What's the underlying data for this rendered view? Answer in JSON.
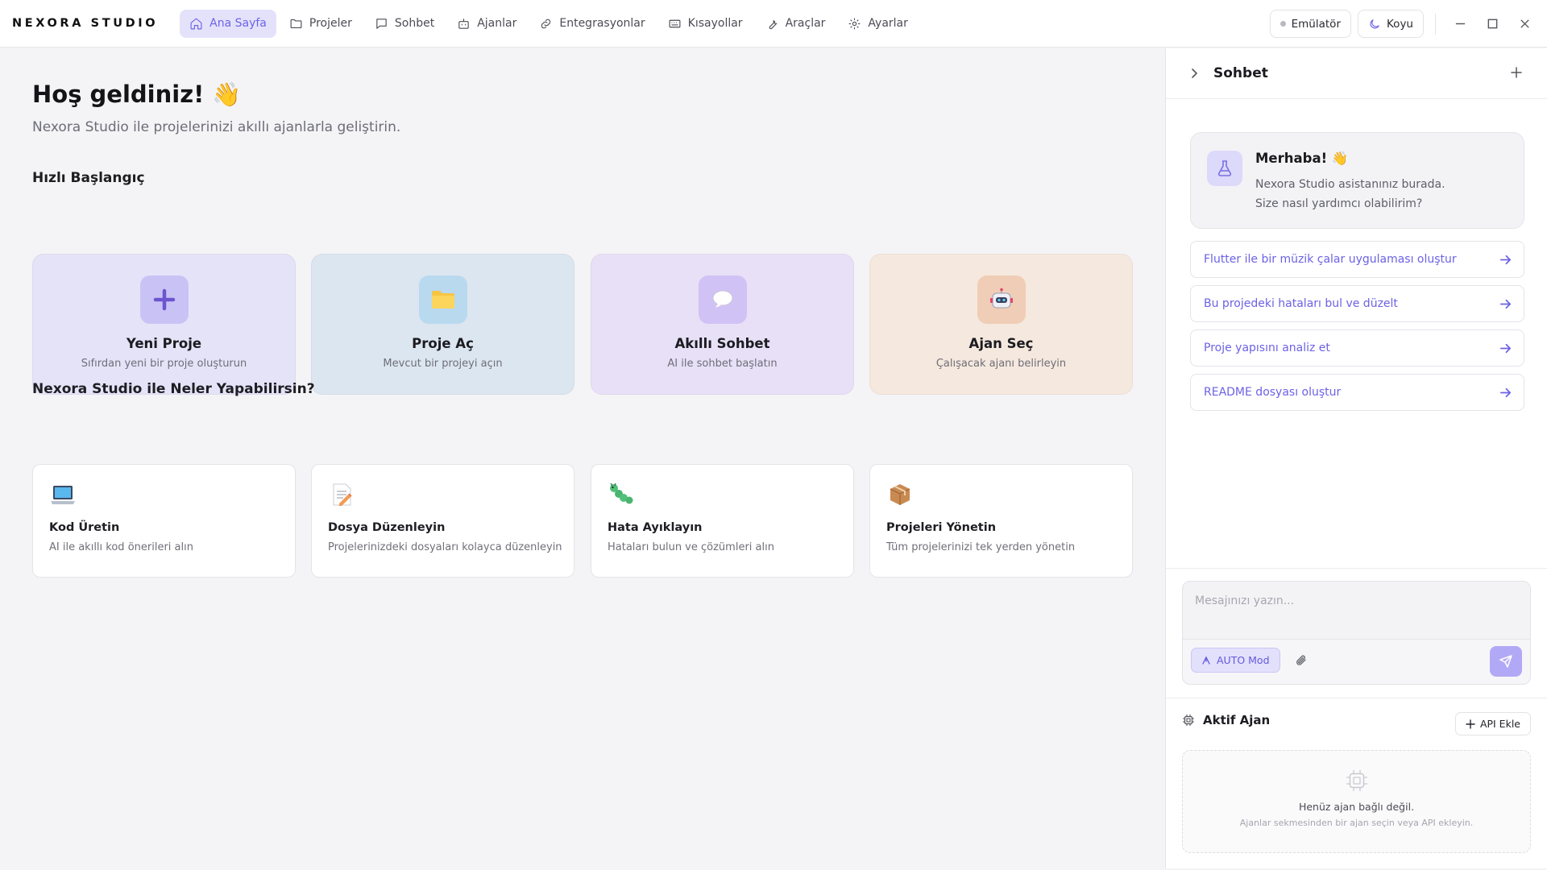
{
  "app": {
    "brand": "NEXORA STUDIO"
  },
  "nav": [
    {
      "label": "Ana Sayfa",
      "icon": "home-icon",
      "active": true
    },
    {
      "label": "Projeler",
      "icon": "folder-icon"
    },
    {
      "label": "Sohbet",
      "icon": "chat-icon"
    },
    {
      "label": "Ajanlar",
      "icon": "robot-icon"
    },
    {
      "label": "Entegrasyonlar",
      "icon": "link-icon"
    },
    {
      "label": "Kısayollar",
      "icon": "keyboard-icon"
    },
    {
      "label": "Araçlar",
      "icon": "wrench-icon"
    },
    {
      "label": "Ayarlar",
      "icon": "gear-icon"
    }
  ],
  "topright": {
    "emulator": "Emülatör",
    "theme": "Koyu"
  },
  "main": {
    "welcome": "Hoş geldiniz! 👋",
    "subtitle": "Nexora Studio ile projelerinizi akıllı ajanlarla geliştirin.",
    "quick_title": "Hızlı Başlangıç",
    "quick": [
      {
        "title": "Yeni Proje",
        "desc": "Sıfırdan yeni bir proje oluşturun",
        "icon": "plus-icon",
        "bg": "#e5e3f8",
        "icon_bg": "#c9c3f5"
      },
      {
        "title": "Proje Aç",
        "desc": "Mevcut bir projeyi açın",
        "icon": "folder-icon",
        "bg": "#dce6f0",
        "icon_bg": "#b9d9ef"
      },
      {
        "title": "Akıllı Sohbet",
        "desc": "AI ile sohbet başlatın",
        "icon": "speech-bubble-icon",
        "bg": "#e8e0f7",
        "icon_bg": "#d1c2f5"
      },
      {
        "title": "Ajan Seç",
        "desc": "Çalışacak ajanı belirleyin",
        "icon": "robot-icon",
        "bg": "#f5e8de",
        "icon_bg": "#f0cdb6"
      }
    ],
    "features_title": "Nexora Studio ile Neler Yapabilirsin?",
    "features": [
      {
        "title": "Kod Üretin",
        "desc": "AI ile akıllı kod önerileri alın",
        "icon": "laptop-icon"
      },
      {
        "title": "Dosya Düzenleyin",
        "desc": "Projelerinizdeki dosyaları kolayca düzenleyin",
        "icon": "memo-icon"
      },
      {
        "title": "Hata Ayıklayın",
        "desc": "Hataları bulun ve çözümleri alın",
        "icon": "bug-icon"
      },
      {
        "title": "Projeleri Yönetin",
        "desc": "Tüm projelerinizi tek yerden yönetin",
        "icon": "package-icon"
      }
    ]
  },
  "chat": {
    "title": "Sohbet",
    "greeting_title": "Merhaba! 👋",
    "greeting_line1": "Nexora Studio asistanınız burada.",
    "greeting_line2": "Size nasıl yardımcı olabilirim?",
    "suggestions": [
      "Flutter ile bir müzik çalar uygulaması oluştur",
      "Bu projedeki hataları bul ve düzelt",
      "Proje yapısını analiz et",
      "README dosyası oluştur"
    ],
    "input_placeholder": "Mesajınızı yazın...",
    "mode_label": "AUTO Mod"
  },
  "agent": {
    "title": "Aktif Ajan",
    "api_button": "API Ekle",
    "empty_title": "Henüz ajan bağlı değil.",
    "empty_desc": "Ajanlar sekmesinden bir ajan seçin veya API ekleyin."
  },
  "colors": {
    "accent": "#6d63e6",
    "accent_light": "#e4e2fb"
  }
}
